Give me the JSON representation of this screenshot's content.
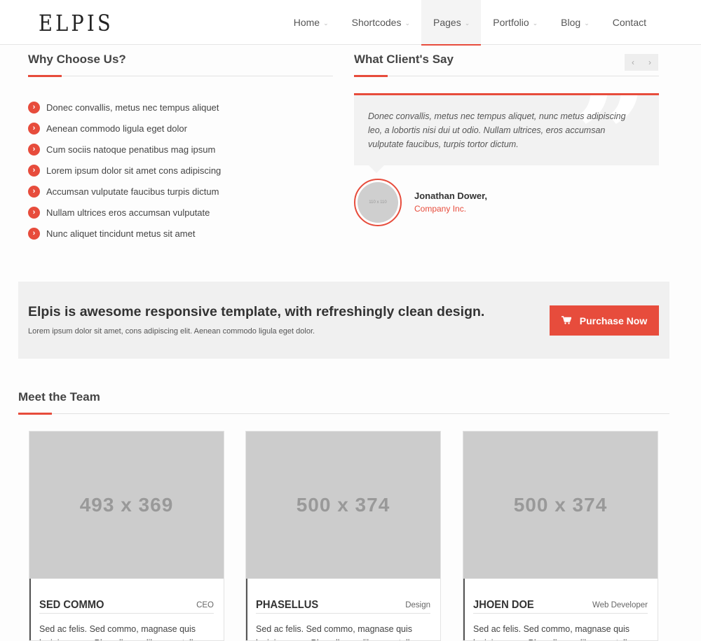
{
  "brand": {
    "logo": "ELPIS"
  },
  "nav": [
    {
      "label": "Home",
      "dropdown": true
    },
    {
      "label": "Shortcodes",
      "dropdown": true
    },
    {
      "label": "Pages",
      "dropdown": true,
      "active": true
    },
    {
      "label": "Portfolio",
      "dropdown": true
    },
    {
      "label": "Blog",
      "dropdown": true
    },
    {
      "label": "Contact",
      "dropdown": false
    }
  ],
  "why": {
    "title": "Why Choose Us?",
    "items": [
      "Donec convallis, metus nec tempus aliquet",
      "Aenean commodo ligula eget dolor",
      "Cum sociis natoque penatibus mag ipsum",
      "Lorem ipsum dolor sit amet cons adipiscing",
      "Accumsan vulputate faucibus turpis dictum",
      "Nullam ultrices eros accumsan vulputate",
      "Nunc aliquet tincidunt metus sit amet"
    ]
  },
  "testimonial": {
    "title": "What Client's Say",
    "prev": "‹",
    "next": "›",
    "quote": "Donec convallis, metus nec tempus aliquet, nunc metus adipiscing leo, a lobortis nisi dui ut odio. Nullam ultrices, eros accumsan vulputate faucibus, turpis tortor dictum.",
    "avatar_text": "110 x 110",
    "client_name": "Jonathan Dower,",
    "client_company": "Company Inc."
  },
  "cta": {
    "title": "Elpis is awesome responsive template, with refreshingly clean design.",
    "text": "Lorem ipsum dolor sit amet, cons adipiscing elit. Aenean commodo ligula eget dolor.",
    "button": "Purchase Now"
  },
  "team": {
    "title": "Meet the Team",
    "members": [
      {
        "image": "493 x 369",
        "name": "SED COMMO",
        "role": "CEO",
        "desc": "Sed ac felis. Sed commo, magnase quis lacinia ornare Phasellus ac libero ac tellus"
      },
      {
        "image": "500 x 374",
        "name": "PHASELLUS",
        "role": "Design",
        "desc": "Sed ac felis. Sed commo, magnase quis lacinia ornare Phasellus ac libero ac tellus"
      },
      {
        "image": "500 x 374",
        "name": "JHOEN DOE",
        "role": "Web Developer",
        "desc": "Sed ac felis. Sed commo, magnase quis lacinia ornare Phasellus ac libero ac tellus"
      }
    ]
  },
  "colors": {
    "accent": "#e74c3c",
    "placeholder": "#cccccc",
    "panel": "#f0f0f0"
  }
}
